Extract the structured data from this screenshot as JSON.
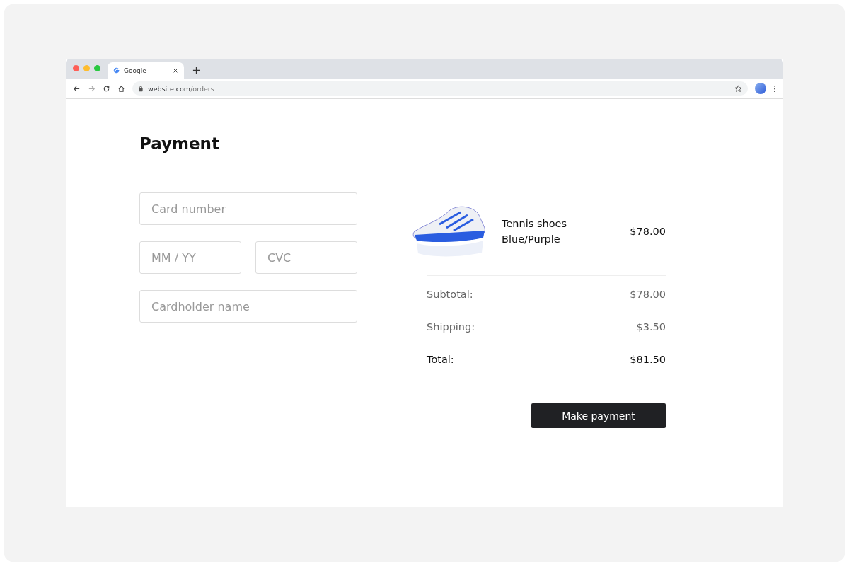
{
  "browser": {
    "tabs": [
      {
        "title": "Google",
        "selected": true
      }
    ],
    "address": {
      "host": "website.com",
      "path": "/orders"
    }
  },
  "title": "Payment",
  "fields": [
    {
      "placeholder": "Card number"
    },
    {
      "placeholder": "MM / YY"
    },
    {
      "placeholder": "CVC"
    },
    {
      "placeholder": "Cardholder name"
    }
  ],
  "item": {
    "name": "Tennis shoes",
    "variant": "Blue/Purple",
    "price": "$78.00"
  },
  "summary": [
    {
      "label": "Subtotal:",
      "value": "$78.00",
      "kind": "normal"
    },
    {
      "label": "Shipping:",
      "value": "$3.50",
      "kind": "normal"
    },
    {
      "label": "Total:",
      "value": "$81.50",
      "kind": "total"
    }
  ],
  "button": "Make payment"
}
